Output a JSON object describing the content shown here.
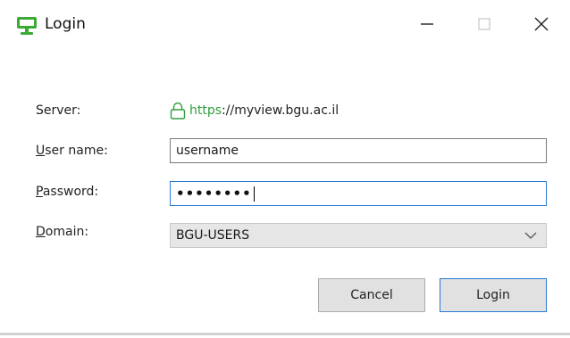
{
  "window": {
    "title": "Login",
    "controls": {
      "minimize": "minimize",
      "maximize": "maximize",
      "close": "close"
    },
    "accent_color": "#2a78d6",
    "icon_color": "#3aaa35"
  },
  "form": {
    "server": {
      "label": "Server:",
      "url_scheme": "https",
      "url_rest": "://myview.bgu.ac.il"
    },
    "username": {
      "label_mnemonic": "U",
      "label_rest": "ser name:",
      "value": "username"
    },
    "password": {
      "label_mnemonic": "P",
      "label_rest": "assword:",
      "value_masked": "••••••••"
    },
    "domain": {
      "label_mnemonic": "D",
      "label_rest": "omain:",
      "selected": "BGU-USERS"
    }
  },
  "buttons": {
    "cancel": "Cancel",
    "login": "Login"
  }
}
